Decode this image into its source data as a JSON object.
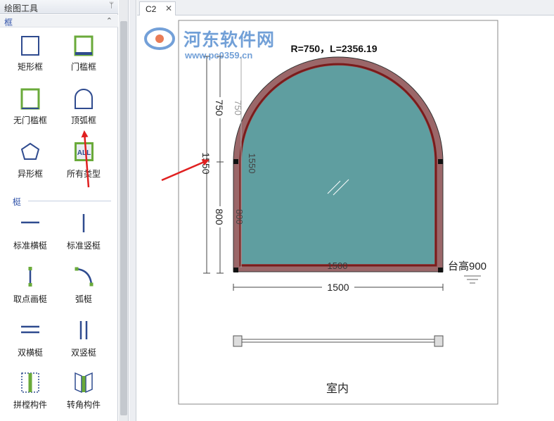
{
  "panel": {
    "title": "绘图工具",
    "pin_glyph": "ᛘ",
    "frame_section": "框",
    "collapse_glyph": "⌃",
    "frames": [
      {
        "label": "矩形框"
      },
      {
        "label": "门槛框"
      },
      {
        "label": "无门槛框"
      },
      {
        "label": "顶弧框"
      },
      {
        "label": "异形框"
      },
      {
        "label": "所有类型",
        "icon_text": "ALL"
      }
    ],
    "mullion_section": "梃",
    "mullions": [
      {
        "label": "标准横梃"
      },
      {
        "label": "标准竖梃"
      },
      {
        "label": "取点画梃"
      },
      {
        "label": "弧梃"
      },
      {
        "label": "双横梃"
      },
      {
        "label": "双竖梃"
      },
      {
        "label": "拼樘构件"
      },
      {
        "label": "转角构件"
      }
    ]
  },
  "tabs": [
    {
      "label": "C2",
      "close_glyph": "✕"
    }
  ],
  "watermark": {
    "name": "河东软件网",
    "url": "www.pc0359.cn"
  },
  "drawing": {
    "header": "R=750，L=2356.19",
    "dim_arch": "750",
    "dim_arch_inner": "750",
    "dim_total": "1550",
    "dim_total_inner": "1550",
    "dim_lower": "800",
    "dim_lower_inner": "800",
    "dim_width_inner": "1500",
    "dim_width": "1500",
    "sill_label": "台高900",
    "indoor_label": "室内"
  },
  "colors": {
    "frame_fill": "#9b6769",
    "frame_line": "#7a1c1c",
    "glass": "#5f9ea0",
    "icon_blue": "#2f4b8f",
    "icon_green": "#6aaa3a",
    "arrow_red": "#e02020",
    "watermark_blue": "#3d7cc9"
  }
}
